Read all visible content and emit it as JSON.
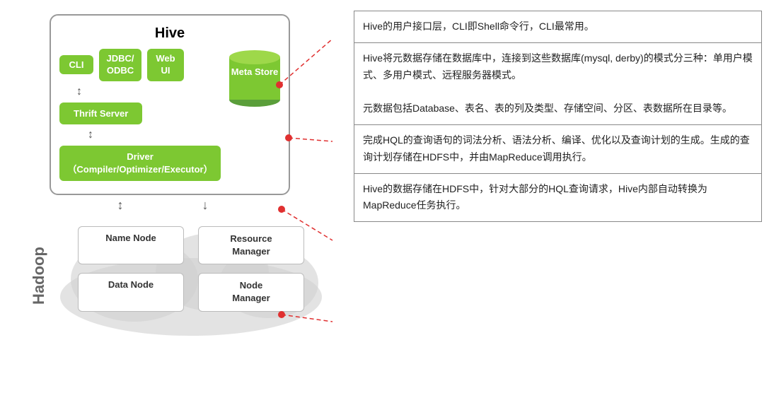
{
  "diagram": {
    "hive_title": "Hive",
    "cli_label": "CLI",
    "jdbc_label": "JDBC/\nODBC",
    "webui_label": "Web\nUI",
    "thrift_label": "Thrift Server",
    "metastore_label": "Meta\nStore",
    "driver_label": "Driver（Compiler/Optimizer/Executor）",
    "hadoop_label": "Hadoop",
    "name_node_label": "Name Node",
    "resource_manager_label": "Resource\nManager",
    "data_node_label": "Data Node",
    "node_manager_label": "Node\nManager"
  },
  "annotations": [
    {
      "id": "ann1",
      "text": "Hive的用户接口层，CLI即Shell命令行，CLI最常用。"
    },
    {
      "id": "ann2",
      "text": "Hive将元数据存储在数据库中，连接到这些数据库(mysql, derby)的模式分三种：单用户模式、多用户模式、远程服务器模式。\n\n元数据包括Database、表名、表的列及类型、存储空间、分区、表数据所在目录等。"
    },
    {
      "id": "ann3",
      "text": "完成HQL的查询语句的词法分析、语法分析、编译、优化以及查询计划的生成。生成的查询计划存储在HDFS中，并由MapReduce调用执行。"
    },
    {
      "id": "ann4",
      "text": "Hive的数据存储在HDFS中，针对大部分的HQL查询请求，Hive内部自动转换为MapReduce任务执行。"
    }
  ]
}
